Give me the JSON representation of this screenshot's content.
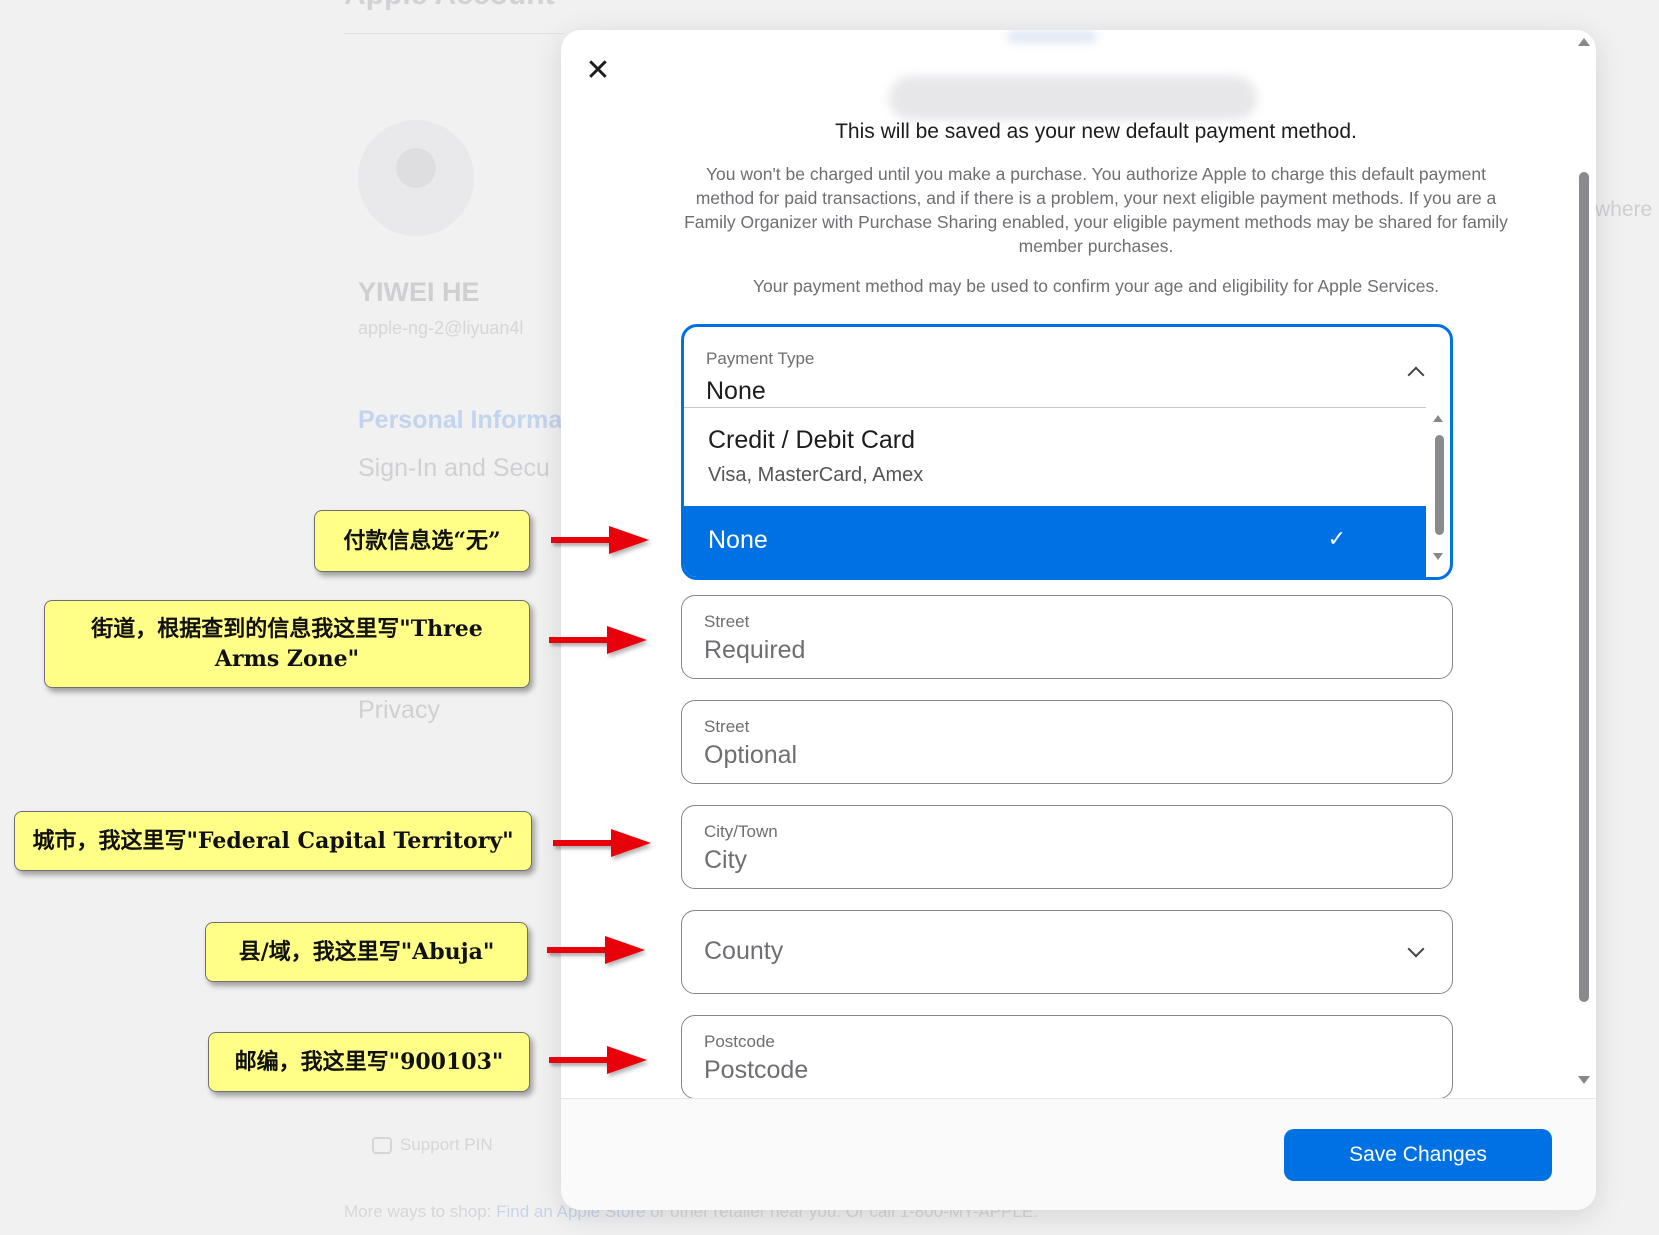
{
  "background": {
    "page_title": "Apple Account",
    "user_name": "YIWEI HE",
    "user_email": "apple-ng-2@liyuan4l",
    "nav_items": [
      "Personal Informa",
      "Sign-In and Secu",
      "Privacy"
    ],
    "support_label": "Support PIN",
    "footer_prefix": "More ways to shop: ",
    "footer_link": "Find an Apple Store",
    "footer_suffix": " or other retailer near you. Or call 1-800-MY-APPLE.",
    "right_text": "where"
  },
  "modal": {
    "close_glyph": "✕",
    "lead": "This will be saved as your new default payment method.",
    "disclaimer": "You won't be charged until you make a purchase. You authorize Apple to charge this default payment method for paid transactions, and if there is a problem, your next eligible payment methods. If you are a Family Organizer with Purchase Sharing enabled, your eligible payment methods may be shared for family member purchases.",
    "age_note": "Your payment method may be used to confirm your age and eligibility for Apple Services.",
    "payment_type": {
      "label": "Payment Type",
      "value": "None",
      "options": [
        {
          "title": "Credit / Debit Card",
          "subtitle": "Visa, MasterCard, Amex"
        },
        {
          "title": "None",
          "selected": true
        }
      ],
      "check_glyph": "✓"
    },
    "fields": {
      "street1": {
        "label": "Street",
        "placeholder": "Required"
      },
      "street2": {
        "label": "Street",
        "placeholder": "Optional"
      },
      "city": {
        "label": "City/Town",
        "placeholder": "City"
      },
      "county": {
        "placeholder": "County"
      },
      "postcode": {
        "label": "Postcode",
        "placeholder": "Postcode"
      }
    },
    "save_label": "Save Changes",
    "accent_color": "#0071e3"
  },
  "annotations": {
    "payment": "付款信息选“无”",
    "street": "街道，根据查到的信息我这里写\"Three Arms Zone\"",
    "city": "城市，我这里写\"Federal Capital Territory\"",
    "county": "县/域，我这里写\"Abuja\"",
    "postcode": "邮编，我这里写\"900103\"",
    "callout_color": "#ffff88",
    "arrow_color": "#e8000b"
  }
}
